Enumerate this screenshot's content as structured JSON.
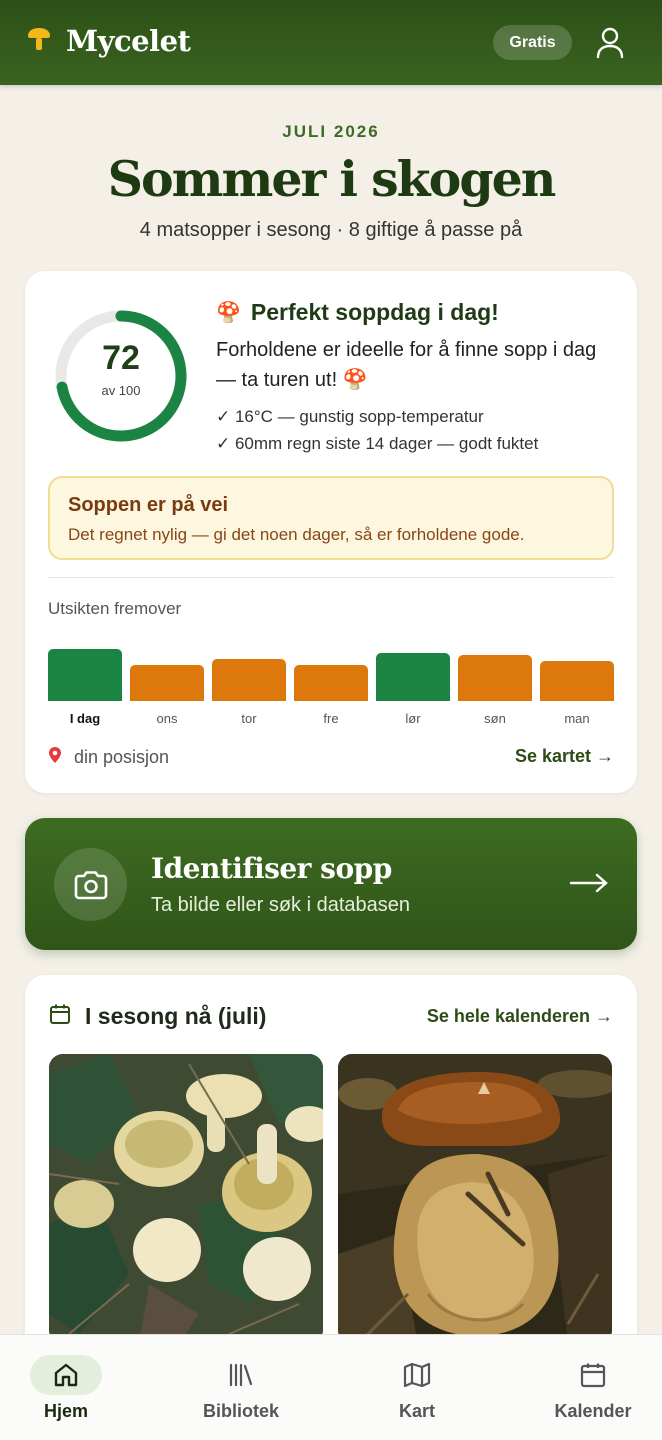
{
  "app": {
    "name": "Mycelet",
    "plan_badge": "Gratis"
  },
  "hero": {
    "month": "JULI 2026",
    "title": "Sommer i skogen",
    "subtitle": "4 matsopper i sesong · 8 giftige å passe på"
  },
  "score": {
    "value": "72",
    "max_label": "av 100",
    "fraction": 0.72,
    "emoji": "🍄",
    "headline": "Perfekt soppdag i dag!",
    "description": "Forholdene er ideelle for å finne sopp i dag — ta turen ut! 🍄",
    "checks": [
      "✓ 16°C — gunstig sopp-temperatur",
      "✓ 60mm regn siste 14 dager — godt fuktet"
    ]
  },
  "alert": {
    "title": "Soppen er på vei",
    "text": "Det regnet nylig — gi det noen dager, så er forholdene gode."
  },
  "outlook": {
    "label": "Utsikten fremover",
    "days": [
      {
        "label": "I dag",
        "level": 1.0,
        "status": "good"
      },
      {
        "label": "ons",
        "level": 0.69,
        "status": "fair"
      },
      {
        "label": "tor",
        "level": 0.81,
        "status": "fair"
      },
      {
        "label": "fre",
        "level": 0.69,
        "status": "fair"
      },
      {
        "label": "lør",
        "level": 0.92,
        "status": "good"
      },
      {
        "label": "søn",
        "level": 0.88,
        "status": "fair"
      },
      {
        "label": "man",
        "level": 0.77,
        "status": "fair"
      }
    ],
    "colors": {
      "good": "#1b8443",
      "fair": "#dd780c"
    }
  },
  "location": {
    "label": "din posisjon",
    "map_link": "Se kartet →"
  },
  "identify": {
    "title": "Identifiser sopp",
    "subtitle": "Ta bilde eller søk i databasen"
  },
  "season": {
    "title": "I sesong nå (juli)",
    "link": "Se hele kalenderen →",
    "cards": [
      {
        "name": "chanterelle-photo"
      },
      {
        "name": "porcini-photo"
      }
    ]
  },
  "nav": {
    "items": [
      {
        "label": "Hjem",
        "icon": "home-icon",
        "active": true
      },
      {
        "label": "Bibliotek",
        "icon": "library-icon",
        "active": false
      },
      {
        "label": "Kart",
        "icon": "map-icon",
        "active": false
      },
      {
        "label": "Kalender",
        "icon": "calendar-icon",
        "active": false
      }
    ]
  },
  "colors": {
    "brand_dark": "#2c5016",
    "accent_green": "#1b8443",
    "accent_orange": "#dd780c",
    "logo_yellow": "#f5b81c"
  }
}
